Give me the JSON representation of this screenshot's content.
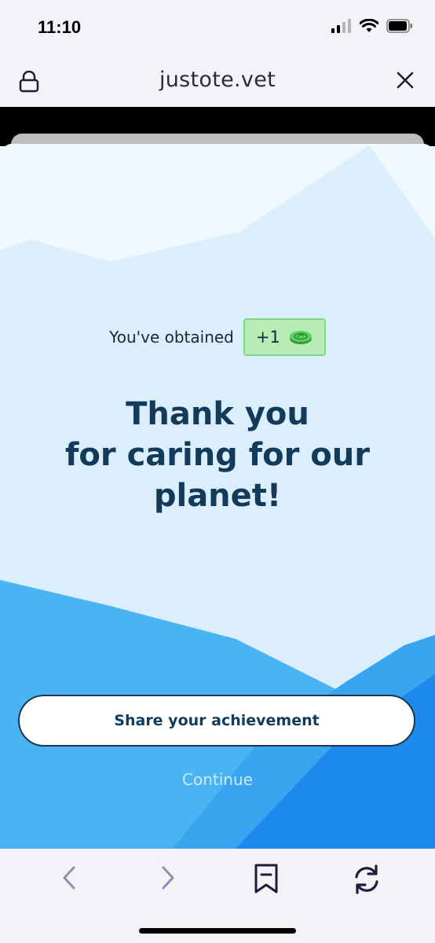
{
  "status_bar": {
    "time": "11:10"
  },
  "browser": {
    "url": "justote.vet"
  },
  "reward": {
    "prefix": "You've obtained",
    "amount": "+1",
    "icon": "green-coin-icon",
    "badge_color": "#b8ecb6"
  },
  "headline": {
    "lines": [
      "Thank you",
      "for caring for our",
      "planet!"
    ]
  },
  "actions": {
    "share_label": "Share your achievement",
    "continue_label": "Continue"
  },
  "toolbar": {
    "icons": [
      "back-icon",
      "forward-icon",
      "bookmark-icon",
      "refresh-icon"
    ]
  },
  "colors": {
    "accent": "#123a5a",
    "sky": "#dbeefb",
    "hill_blue": "#3aa6ef",
    "deep_blue": "#1a86ee"
  }
}
